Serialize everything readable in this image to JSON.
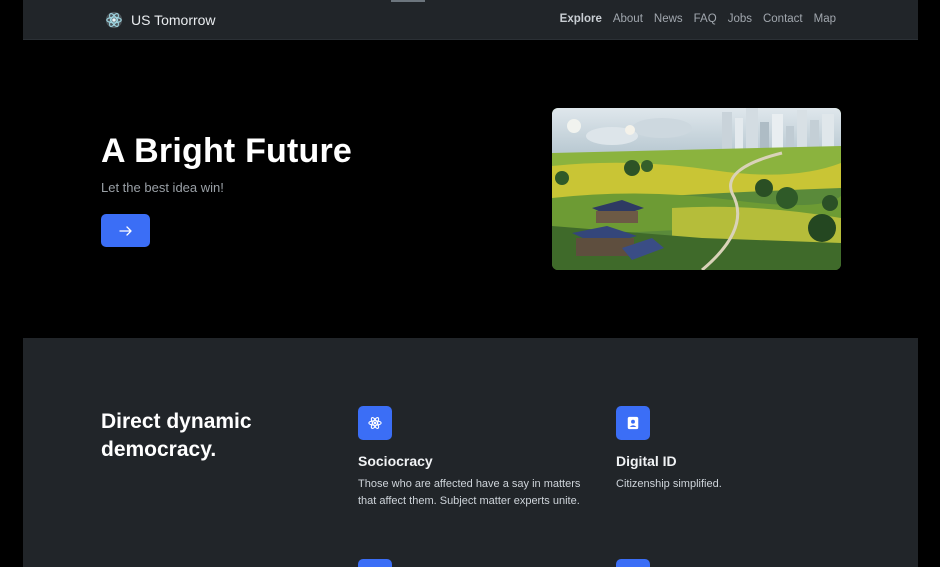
{
  "nav": {
    "brand": "US Tomorrow",
    "links": [
      {
        "label": "Explore",
        "active": true
      },
      {
        "label": "About"
      },
      {
        "label": "News"
      },
      {
        "label": "FAQ"
      },
      {
        "label": "Jobs"
      },
      {
        "label": "Contact"
      },
      {
        "label": "Map"
      }
    ]
  },
  "hero": {
    "title": "A Bright Future",
    "subtitle": "Let the best idea win!",
    "button_icon": "arrow-right-icon",
    "image": "landscape-city-illustration"
  },
  "features": {
    "heading": "Direct dynamic democracy.",
    "items": [
      {
        "icon": "atom-icon",
        "title": "Sociocracy",
        "text": "Those who are affected have a say in matters that affect them. Subject matter experts unite."
      },
      {
        "icon": "person-badge-icon",
        "title": "Digital ID",
        "text": "Citizenship simplified."
      }
    ]
  },
  "colors": {
    "accent": "#3b6ef6",
    "nav_bg": "#212529",
    "hero_bg": "#000000",
    "features_bg": "#212529"
  }
}
